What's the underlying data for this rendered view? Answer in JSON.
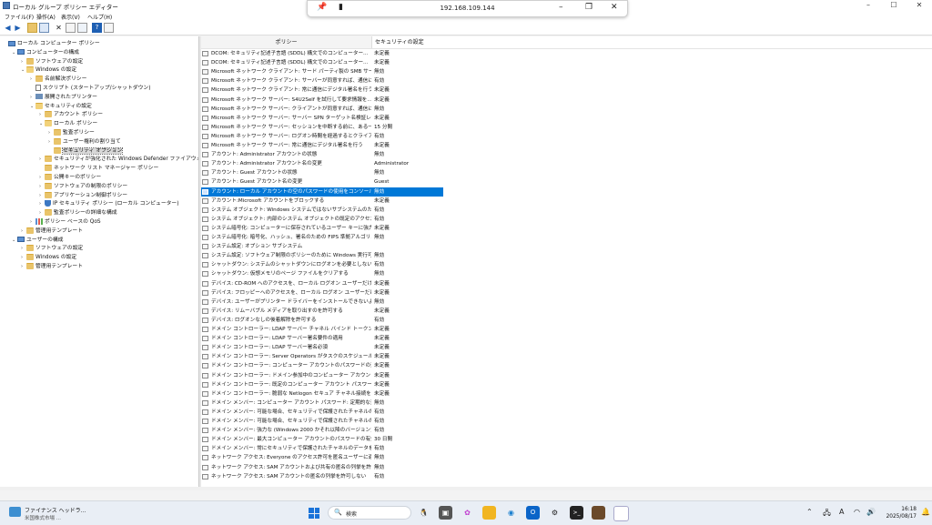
{
  "window": {
    "title": "ローカル グループ ポリシー エディター"
  },
  "remote_bar": {
    "ip": "192.168.109.144"
  },
  "menu": [
    "ファイル(F)",
    "操作(A)",
    "表示(V)",
    "ヘルプ(H)"
  ],
  "list": {
    "col_policy": "ポリシー",
    "col_setting": "セキュリティの設定",
    "selected_index": 15,
    "rows": [
      {
        "name": "DCOM: セキュリティ記述子言語 (SDDL) 構文でのコンピューター...",
        "value": "未定義"
      },
      {
        "name": "DCOM: セキュリティ記述子言語 (SDDL) 構文でのコンピューター...",
        "value": "未定義"
      },
      {
        "name": "Microsoft ネットワーク クライアント: サード パーティ製の SMB サーバ...",
        "value": "無効"
      },
      {
        "name": "Microsoft ネットワーク クライアント: サーバーが同意すれば、通信に...",
        "value": "有効"
      },
      {
        "name": "Microsoft ネットワーク クライアント: 常に通信にデジタル署名を行う",
        "value": "未定義"
      },
      {
        "name": "Microsoft ネットワーク サーバー: S4U2Self を試行して要求情報を...",
        "value": "未定義"
      },
      {
        "name": "Microsoft ネットワーク サーバー: クライアントが同意すれば、通信に...",
        "value": "無効"
      },
      {
        "name": "Microsoft ネットワーク サーバー: サーバー SPN ターゲット名検証レベル",
        "value": "未定義"
      },
      {
        "name": "Microsoft ネットワーク サーバー: セッションを中断する前に、ある一...",
        "value": "15 分間"
      },
      {
        "name": "Microsoft ネットワーク サーバー: ログオン時間を経過するとクライア...",
        "value": "有効"
      },
      {
        "name": "Microsoft ネットワーク サーバー: 常に通信にデジタル署名を行う",
        "value": "未定義"
      },
      {
        "name": "アカウント: Administrator アカウントの状態",
        "value": "無効"
      },
      {
        "name": "アカウント: Administrator アカウント名の変更",
        "value": "Administrator"
      },
      {
        "name": "アカウント: Guest アカウントの状態",
        "value": "無効"
      },
      {
        "name": "アカウント: Guest アカウント名の変更",
        "value": "Guest"
      },
      {
        "name": "アカウント: ローカル アカウントの空のパスワードの使用をコンソール ログ...",
        "value": "無効"
      },
      {
        "name": "アカウント:Microsoft アカウントをブロックする",
        "value": "未定義"
      },
      {
        "name": "システム オブジェクト: Windows システムではないサブシステムのため...",
        "value": "有効"
      },
      {
        "name": "システム オブジェクト: 内部のシステム オブジェクトの既定のアクセス許...",
        "value": "有効"
      },
      {
        "name": "システム暗号化: コンピューターに保存されているユーザー キーに強力な...",
        "value": "未定義"
      },
      {
        "name": "システム暗号化: 暗号化、ハッシュ、署名のための FIPS 準拠アルゴリ...",
        "value": "無効"
      },
      {
        "name": "システム設定: オプション サブシステム",
        "value": ""
      },
      {
        "name": "システム設定: ソフトウェア制限のポリシーのために Windows 実行可...",
        "value": "無効"
      },
      {
        "name": "シャットダウン: システムのシャットダウンにログオンを必要としない",
        "value": "有効"
      },
      {
        "name": "シャットダウン: 仮想メモリのページ ファイルをクリアする",
        "value": "無効"
      },
      {
        "name": "デバイス: CD-ROM へのアクセスを、ローカル ログオン ユーザーだけに...",
        "value": "未定義"
      },
      {
        "name": "デバイス: フロッピーへのアクセスを、ローカル ログオン ユーザーだけに制...",
        "value": "未定義"
      },
      {
        "name": "デバイス: ユーザーがプリンター ドライバーをインストールできないようにする",
        "value": "無効"
      },
      {
        "name": "デバイス: リムーバブル メディアを取り出すのを許可する",
        "value": "未定義"
      },
      {
        "name": "デバイス: ログオンなしの後着解除を許可する",
        "value": "有効"
      },
      {
        "name": "ドメイン コントローラー: LDAP サーバー チャネル バインド トークンの要件",
        "value": "未定義"
      },
      {
        "name": "ドメイン コントローラー: LDAP サーバー署名要件の適用",
        "value": "未定義"
      },
      {
        "name": "ドメイン コントローラー: LDAP サーバー署名必須",
        "value": "未定義"
      },
      {
        "name": "ドメイン コントローラー: Server Operators がタスクのスケジュールを割...",
        "value": "未定義"
      },
      {
        "name": "ドメイン コントローラー: コンピューター アカウントのパスワードの変更を拒...",
        "value": "未定義"
      },
      {
        "name": "ドメイン コントローラー: ドメイン参加中のコンピューター アカウントの再...",
        "value": "未定義"
      },
      {
        "name": "ドメイン コントローラー: 既定のコンピューター アカウント パスワードの設...",
        "value": "未定義"
      },
      {
        "name": "ドメイン コントローラー: 脆弱な Netlogon セキュア チャネル接続を許可",
        "value": "未定義"
      },
      {
        "name": "ドメイン メンバー: コンピューター アカウント パスワード: 定期的な変更を...",
        "value": "無効"
      },
      {
        "name": "ドメイン メンバー: 可能な場合、セキュリティで保護されたチャネルのデ...",
        "value": "有効"
      },
      {
        "name": "ドメイン メンバー: 可能な場合、セキュリティで保護されたチャネルのデ...",
        "value": "有効"
      },
      {
        "name": "ドメイン メンバー: 強力な (Windows 2000 かそれ以降のバージョン)...",
        "value": "有効"
      },
      {
        "name": "ドメイン メンバー: 最大コンピューター アカウントのパスワードの有効期間",
        "value": "30 日間"
      },
      {
        "name": "ドメイン メンバー: 常にセキュリティで保護されたチャネルのデータをデジ...",
        "value": "有効"
      },
      {
        "name": "ネットワーク アクセス: Everyone のアクセス許可を匿名ユーザーに適...",
        "value": "無効"
      },
      {
        "name": "ネットワーク アクセス: SAM アカウントおよび共有の匿名の列挙を許...",
        "value": "無効"
      },
      {
        "name": "ネットワーク アクセス: SAM アカウントの匿名の列挙を許可しない",
        "value": "有効"
      }
    ]
  },
  "tree": [
    {
      "label": "ローカル コンピューター ポリシー",
      "icon": "pc",
      "exp": "",
      "indent": 0
    },
    {
      "label": "コンピューターの構成",
      "icon": "pc",
      "exp": "v",
      "indent": 1
    },
    {
      "label": "ソフトウェアの設定",
      "icon": "folder",
      "exp": ">",
      "indent": 2
    },
    {
      "label": "Windows の設定",
      "icon": "folder-open",
      "exp": "v",
      "indent": 2
    },
    {
      "label": "名前解決ポリシー",
      "icon": "folder",
      "exp": ">",
      "indent": 3
    },
    {
      "label": "スクリプト (スタートアップ/シャットダウン)",
      "icon": "doc",
      "exp": "",
      "indent": 3
    },
    {
      "label": "展開されたプリンター",
      "icon": "net",
      "exp": ">",
      "indent": 3
    },
    {
      "label": "セキュリティの設定",
      "icon": "folder-open",
      "exp": "v",
      "indent": 3
    },
    {
      "label": "アカウント ポリシー",
      "icon": "folder",
      "exp": ">",
      "indent": 4
    },
    {
      "label": "ローカル ポリシー",
      "icon": "folder-open",
      "exp": "v",
      "indent": 4
    },
    {
      "label": "監査ポリシー",
      "icon": "folder",
      "exp": ">",
      "indent": 5
    },
    {
      "label": "ユーザー権利の割り当て",
      "icon": "folder",
      "exp": ">",
      "indent": 5
    },
    {
      "label": "セキュリティ オプション",
      "icon": "folder",
      "exp": "",
      "indent": 5,
      "selected": true
    },
    {
      "label": "セキュリティが強化された Windows Defender ファイアウォール",
      "icon": "folder",
      "exp": ">",
      "indent": 4
    },
    {
      "label": "ネットワーク リスト マネージャー ポリシー",
      "icon": "folder",
      "exp": "",
      "indent": 4
    },
    {
      "label": "公開キーのポリシー",
      "icon": "folder",
      "exp": ">",
      "indent": 4
    },
    {
      "label": "ソフトウェアの制限のポリシー",
      "icon": "folder",
      "exp": ">",
      "indent": 4
    },
    {
      "label": "アプリケーション制御ポリシー",
      "icon": "folder",
      "exp": ">",
      "indent": 4
    },
    {
      "label": "IP セキュリティ ポリシー (ローカル コンピューター)",
      "icon": "shield",
      "exp": ">",
      "indent": 4
    },
    {
      "label": "監査ポリシーの詳細な構成",
      "icon": "folder",
      "exp": ">",
      "indent": 4
    },
    {
      "label": "ポリシー ベースの QoS",
      "icon": "chart",
      "exp": ">",
      "indent": 3
    },
    {
      "label": "管理用テンプレート",
      "icon": "folder",
      "exp": ">",
      "indent": 2
    },
    {
      "label": "ユーザーの構成",
      "icon": "pc",
      "exp": "v",
      "indent": 1
    },
    {
      "label": "ソフトウェアの設定",
      "icon": "folder",
      "exp": ">",
      "indent": 2
    },
    {
      "label": "Windows の設定",
      "icon": "folder",
      "exp": ">",
      "indent": 2
    },
    {
      "label": "管理用テンプレート",
      "icon": "folder",
      "exp": ">",
      "indent": 2
    }
  ],
  "taskbar": {
    "weather_title": "ファイナンス ヘッドラ...",
    "weather_sub": "米国株式市場 ...",
    "search_placeholder": "検索",
    "time": "16:18",
    "date": "2025/08/17",
    "ime": "A"
  }
}
